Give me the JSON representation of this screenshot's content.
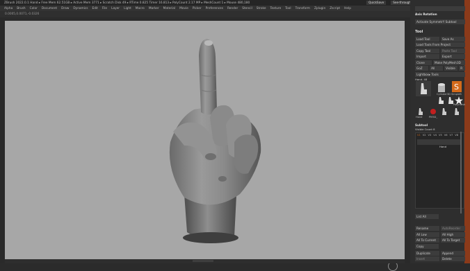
{
  "titlebar": {
    "text": "ZBrush 2022.0.1   Hand   ▸ Free Mem 62.51GB ▸ Active Mem 3771 ▸ Scratch Disk 49 ▸ RTime 0.825 Timer 16.813 ▸ PolyCount 2.17 MP ▸ MeshCount 1 ▸ Mouse 480,180",
    "quicksave": "QuickSave",
    "seethrough": "See-through 0",
    "menus": "Menus",
    "script": "DefaultZScript"
  },
  "menubar": {
    "items": [
      "Alpha",
      "Brush",
      "Color",
      "Document",
      "Draw",
      "Dynamics",
      "Edit",
      "File",
      "Layer",
      "Light",
      "Macro",
      "Marker",
      "Material",
      "Movie",
      "Picker",
      "Preferences",
      "Render",
      "Stencil",
      "Stroke",
      "Texture",
      "Tool",
      "Transform",
      "Zplugin",
      "Zscript",
      "Help"
    ]
  },
  "subbar": {
    "coords": "0.0005,0.0071,-0.0326"
  },
  "panel": {
    "top_field": "",
    "auto_rotation": "Axis Rotation",
    "activate_symmetry": "Activate SymmetrY Subtool",
    "tool_title": "Tool",
    "load_tool": "Load Tool",
    "save_as": "Save As",
    "load_tools_from_project": "Load Tools From Project",
    "copy_tool": "Copy Tool",
    "paste_tool": "Paste Tool",
    "import": "Import",
    "export": "Export",
    "clone": "Clone",
    "make_polymesh": "Make PolyMesh3D",
    "goz": "GoZ",
    "all": "All",
    "visible": "Visible",
    "r": "R",
    "lightbox_tools": "Lightbox▸ Tools",
    "current_tool": "Hand. 48",
    "tool_labels": [
      "Hand",
      "Cylinder3D",
      "SimpleB",
      "PM3D_",
      "Polymesh",
      "Sphere3D",
      "PM3D_",
      "ZSphere",
      "Hand_",
      "CylinderXYZ"
    ],
    "subtool_title": "Subtool",
    "visible_count": "Visible Count 8",
    "subtool_items": [
      "V1",
      "V2",
      "V3",
      "V4",
      "V5",
      "V6",
      "V7",
      "V8"
    ],
    "subtool_name": "Hand",
    "list_all": "List All",
    "rename": "Rename",
    "autoreorder": "AutoReorder",
    "all_low": "All Low",
    "all_high": "All High",
    "all_to_current": "All To Current",
    "all_to_target": "All To Target",
    "copy": "Copy",
    "duplicate": "Duplicate",
    "append": "Append",
    "insert": "Insert",
    "delete": "Delete"
  },
  "colors": {
    "accent": "#d46a1a",
    "viewport": "#a7a7a7",
    "panel": "#2e2e2e"
  }
}
